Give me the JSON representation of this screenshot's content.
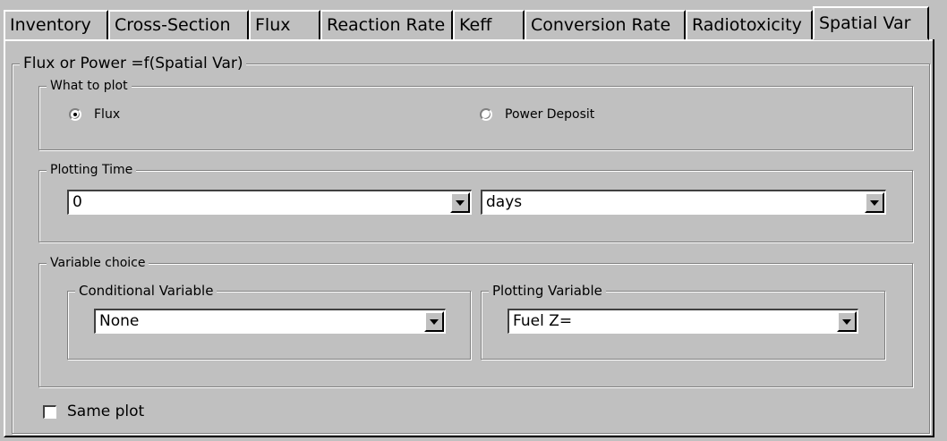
{
  "tabs": [
    {
      "label": "Inventory",
      "active": false
    },
    {
      "label": "Cross-Section",
      "active": false
    },
    {
      "label": "Flux",
      "active": false
    },
    {
      "label": "Reaction Rate",
      "active": false
    },
    {
      "label": "Keff",
      "active": false
    },
    {
      "label": "Conversion Rate",
      "active": false
    },
    {
      "label": "Radiotoxicity",
      "active": false
    },
    {
      "label": "Spatial Var",
      "active": true
    }
  ],
  "main_group": {
    "title": "Flux or Power =f(Spatial Var)"
  },
  "what_to_plot": {
    "title": "What to plot",
    "options": [
      {
        "label": "Flux",
        "selected": true
      },
      {
        "label": "Power Deposit",
        "selected": false
      }
    ]
  },
  "plotting_time": {
    "title": "Plotting Time",
    "time_value": "0",
    "unit_value": "days"
  },
  "variable_choice": {
    "title": "Variable choice",
    "conditional": {
      "title": "Conditional Variable",
      "value": "None"
    },
    "plotting": {
      "title": "Plotting Variable",
      "value": "Fuel Z="
    }
  },
  "same_plot": {
    "label": "Same plot",
    "checked": false
  },
  "icons": {
    "dropdown": "chevron-down-icon"
  }
}
